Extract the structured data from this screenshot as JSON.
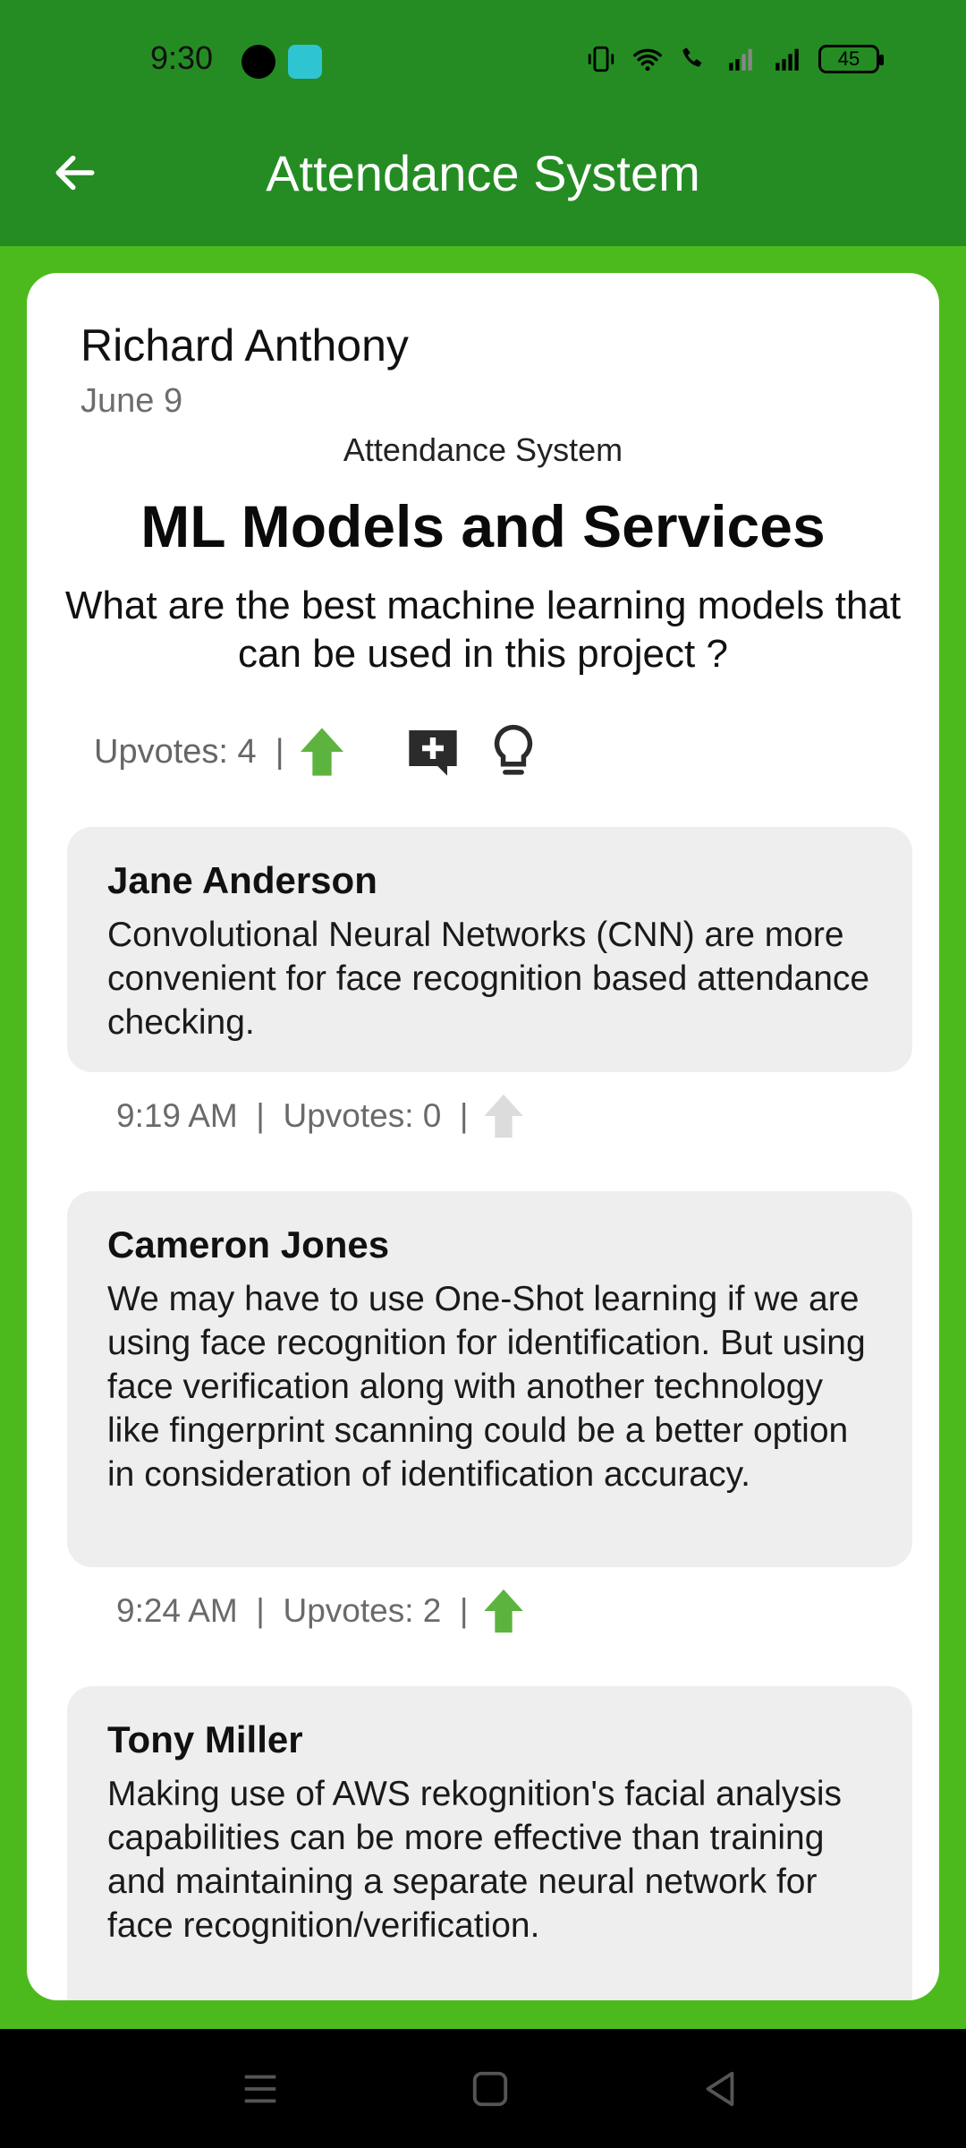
{
  "status_bar": {
    "time": "9:30",
    "battery": "45"
  },
  "app_bar": {
    "title": "Attendance System"
  },
  "post": {
    "author": "Richard Anthony",
    "date": "June 9",
    "category": "Attendance System",
    "title": "ML Models and Services",
    "question": "What are the best machine learning models that can be used in this project ?",
    "upvotes_label": "Upvotes: 4  |",
    "upvoted": true
  },
  "replies": [
    {
      "name": "Jane Anderson",
      "body": "Convolutional Neural Networks (CNN) are more convenient for face recognition based attendance checking.",
      "meta": "9:19 AM  |  Upvotes: 0  |",
      "upvoted": false
    },
    {
      "name": "Cameron Jones",
      "body": "We may have to use One-Shot learning if we are using face recognition for identification. But using face verification along with another technology like fingerprint scanning could be a better option in consideration of identification accuracy.",
      "meta": "9:24 AM  |  Upvotes: 2  |",
      "upvoted": true
    },
    {
      "name": "Tony Miller",
      "body": "Making use of AWS rekognition's facial analysis capabilities can be more effective than training and maintaining a separate neural network for face recognition/verification.",
      "meta": "",
      "upvoted": false
    }
  ],
  "colors": {
    "app_bar": "#248c23",
    "background": "#4cba1c",
    "upvote_active": "#5cb43e",
    "upvote_inactive": "#dcdcdc"
  },
  "icons": {
    "back": "arrow-left-icon",
    "upvote": "arrow-up-icon",
    "add_comment": "add-comment-icon",
    "idea": "lightbulb-icon"
  }
}
